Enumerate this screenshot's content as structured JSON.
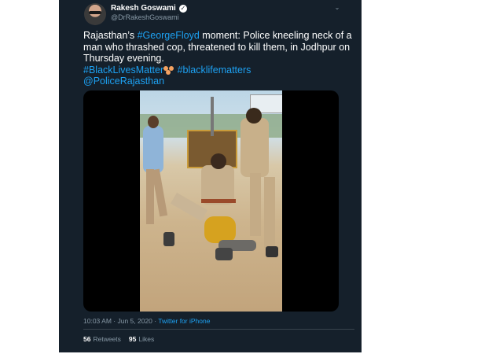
{
  "author": {
    "display_name": "Rakesh Goswami",
    "handle": "@DrRakeshGoswami",
    "verified": true,
    "verified_icon": "verified-badge-icon",
    "caret_icon": "chevron-down-icon"
  },
  "tweet": {
    "text_part1": "Rajasthan’s ",
    "hashtag_george": "#GeorgeFloyd",
    "text_part2": " moment: Police kneeling neck of a man who thrashed cop, threatened to kill them, in Jodhpur on Thursday evening.",
    "hashtag_blm": "#BlackLivesMatter",
    "emoji_icon": "eyes-emoji-icon",
    "hashtag_blacklife": "#blacklifematters",
    "mention": "@PoliceRajasthan"
  },
  "meta": {
    "timestamp": "10:03 AM · Jun 5, 2020 · ",
    "source": "Twitter for iPhone"
  },
  "stats": {
    "retweets_count": "56",
    "retweets_label": "Retweets",
    "likes_count": "95",
    "likes_label": "Likes"
  },
  "colors": {
    "background": "#15202b",
    "link": "#1da1f2",
    "muted": "#8899a6"
  }
}
